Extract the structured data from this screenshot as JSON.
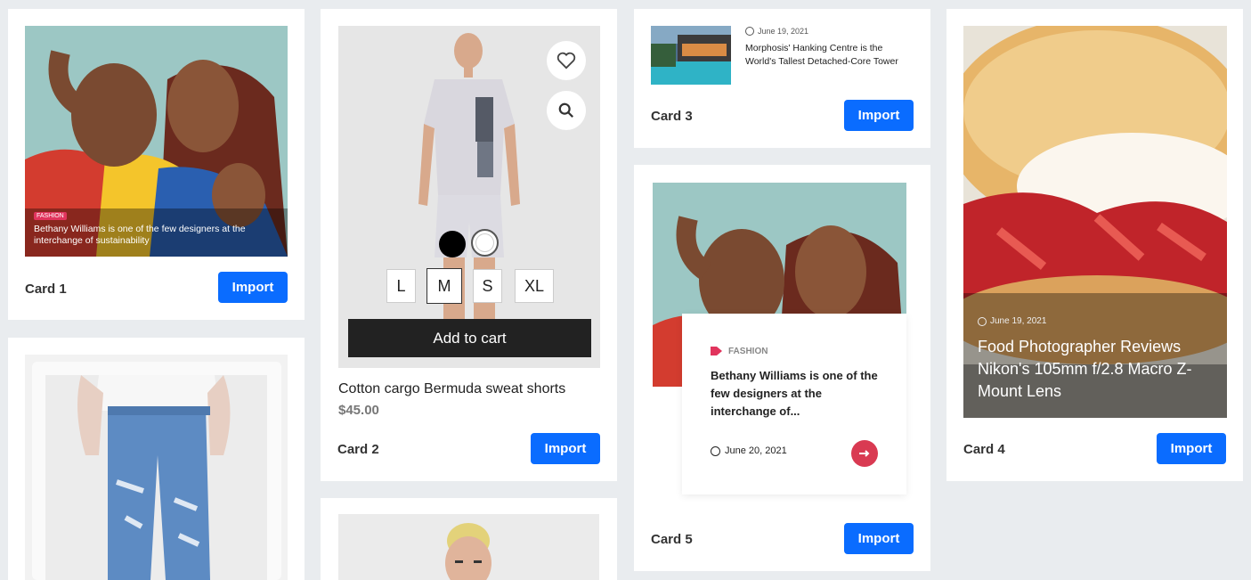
{
  "colors": {
    "accent": "#0a6cff",
    "tag": "#e1345d",
    "page_bg": "#e9ecef"
  },
  "card1": {
    "label": "Card 1",
    "import": "Import",
    "tag": "FASHION",
    "caption": "Bethany Williams is one of the few designers at the interchange of sustainability"
  },
  "card2": {
    "label": "Card 2",
    "import": "Import",
    "sizes": [
      "L",
      "M",
      "S",
      "XL"
    ],
    "add_to_cart": "Add to cart",
    "title": "Cotton cargo Bermuda sweat shorts",
    "price": "$45.00",
    "selected_size": "M"
  },
  "card3": {
    "label": "Card 3",
    "import": "Import",
    "date": "June 19, 2021",
    "title": "Morphosis' Hanking Centre is the World's Tallest Detached-Core Tower"
  },
  "card4": {
    "label": "Card 4",
    "import": "Import",
    "date": "June 19, 2021",
    "title": "Food Photographer Reviews Nikon's 105mm f/2.8 Macro Z-Mount Lens"
  },
  "card5": {
    "label": "Card 5",
    "import": "Import",
    "tag": "FASHION",
    "title": "Bethany Williams is one of the few designers at the interchange of...",
    "date": "June 20, 2021"
  }
}
